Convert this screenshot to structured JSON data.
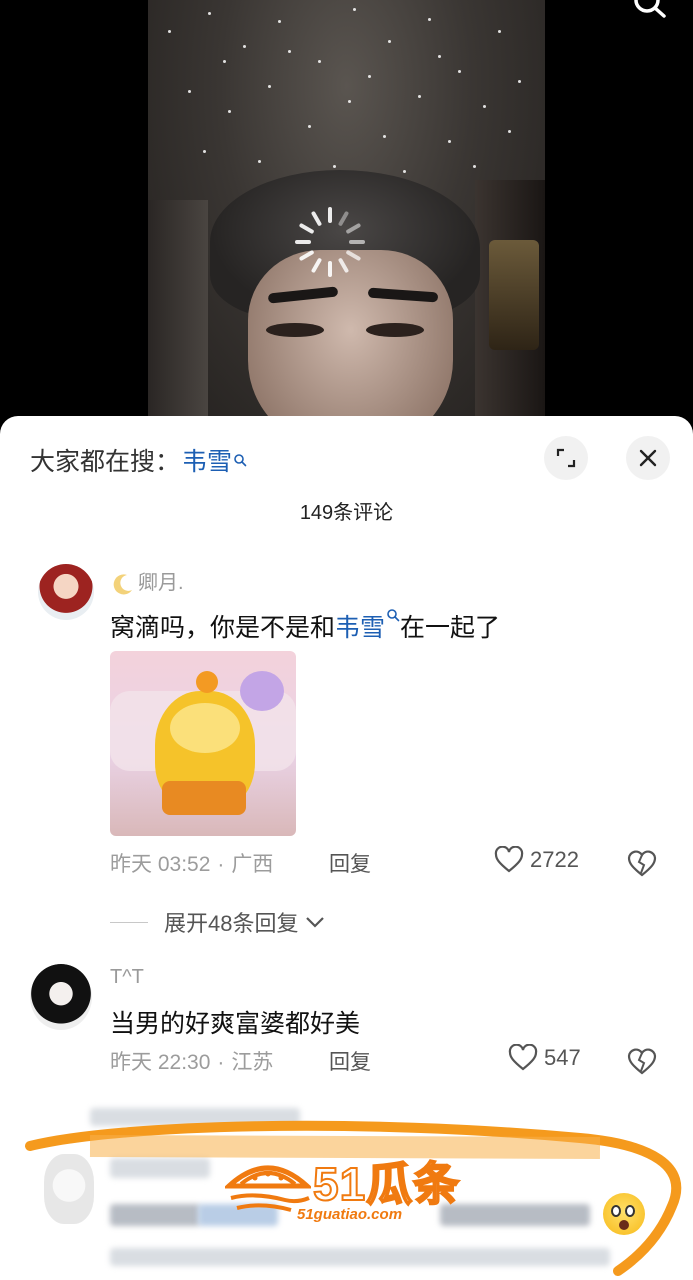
{
  "sheet": {
    "search_prefix": "大家都在搜：",
    "search_keyword": "韦雪",
    "comment_count": "149条评论"
  },
  "comments": [
    {
      "username": "卿月.",
      "text_before": "窝滴吗，你是不是和",
      "keyword": "韦雪",
      "text_after": "在一起了",
      "time": "昨天 03:52",
      "location": "广西",
      "reply_label": "回复",
      "likes": "2722",
      "expand_replies": "展开48条回复"
    },
    {
      "username": "T^T",
      "text": "当男的好爽富婆都好美",
      "time": "昨天 22:30",
      "location": "江苏",
      "reply_label": "回复",
      "likes": "547"
    }
  ],
  "watermark": {
    "brand": "51瓜条",
    "url": "51guatiao.com"
  },
  "colors": {
    "link": "#1d5fb3",
    "accent_orange": "#f07a10"
  }
}
